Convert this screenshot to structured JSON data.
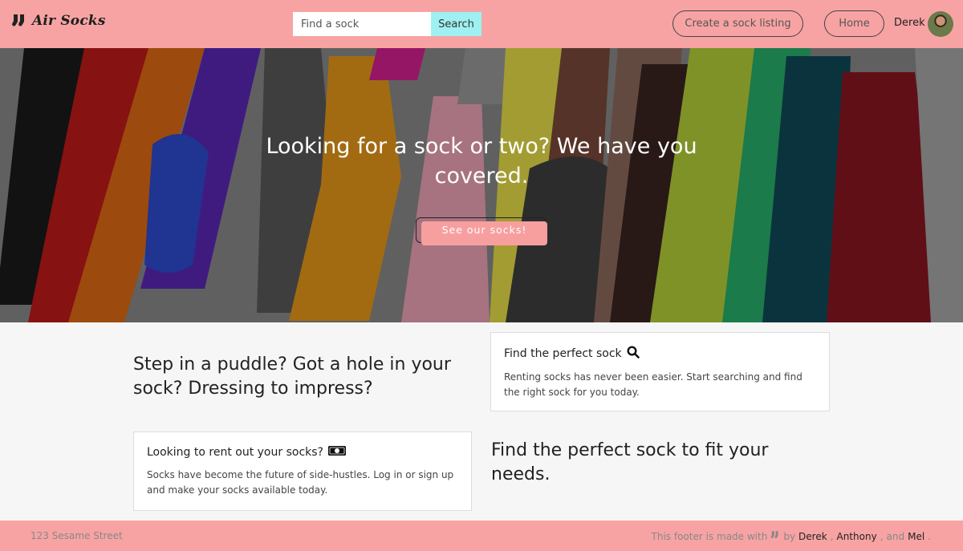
{
  "brand": {
    "name": "Air Socks",
    "icon": "socks-icon"
  },
  "search": {
    "placeholder": "Find a sock",
    "value": "",
    "button_label": "Search"
  },
  "nav": {
    "create_label": "Create a sock listing",
    "home_label": "Home",
    "user_name": "Derek"
  },
  "hero": {
    "title": "Looking for a sock or two? We have you covered.",
    "button_label": "See our socks!"
  },
  "content": {
    "headline_left": "Step in a puddle? Got a hole in your sock? Dressing to impress?",
    "headline_right": "Find the perfect sock to fit your needs.",
    "card_find": {
      "title": "Find the perfect sock",
      "icon": "search-icon",
      "text": "Renting socks has never been easier. Start searching and find the right sock for you today."
    },
    "card_rent": {
      "title": "Looking to rent out your socks?",
      "icon": "money-icon",
      "text": "Socks have become the future of side-hustles. Log in or sign up and make your socks available today."
    }
  },
  "footer": {
    "address": "123 Sesame Street",
    "credit_prefix": "This footer is made with",
    "credit_by": "by",
    "authors": [
      "Derek",
      "Anthony",
      "Mel"
    ],
    "comma": ",",
    "and": "and",
    "period": "."
  },
  "colors": {
    "navbar": "#f7a3a3",
    "search_button": "#9ff0f0",
    "hero_button": "#f79f9f"
  }
}
